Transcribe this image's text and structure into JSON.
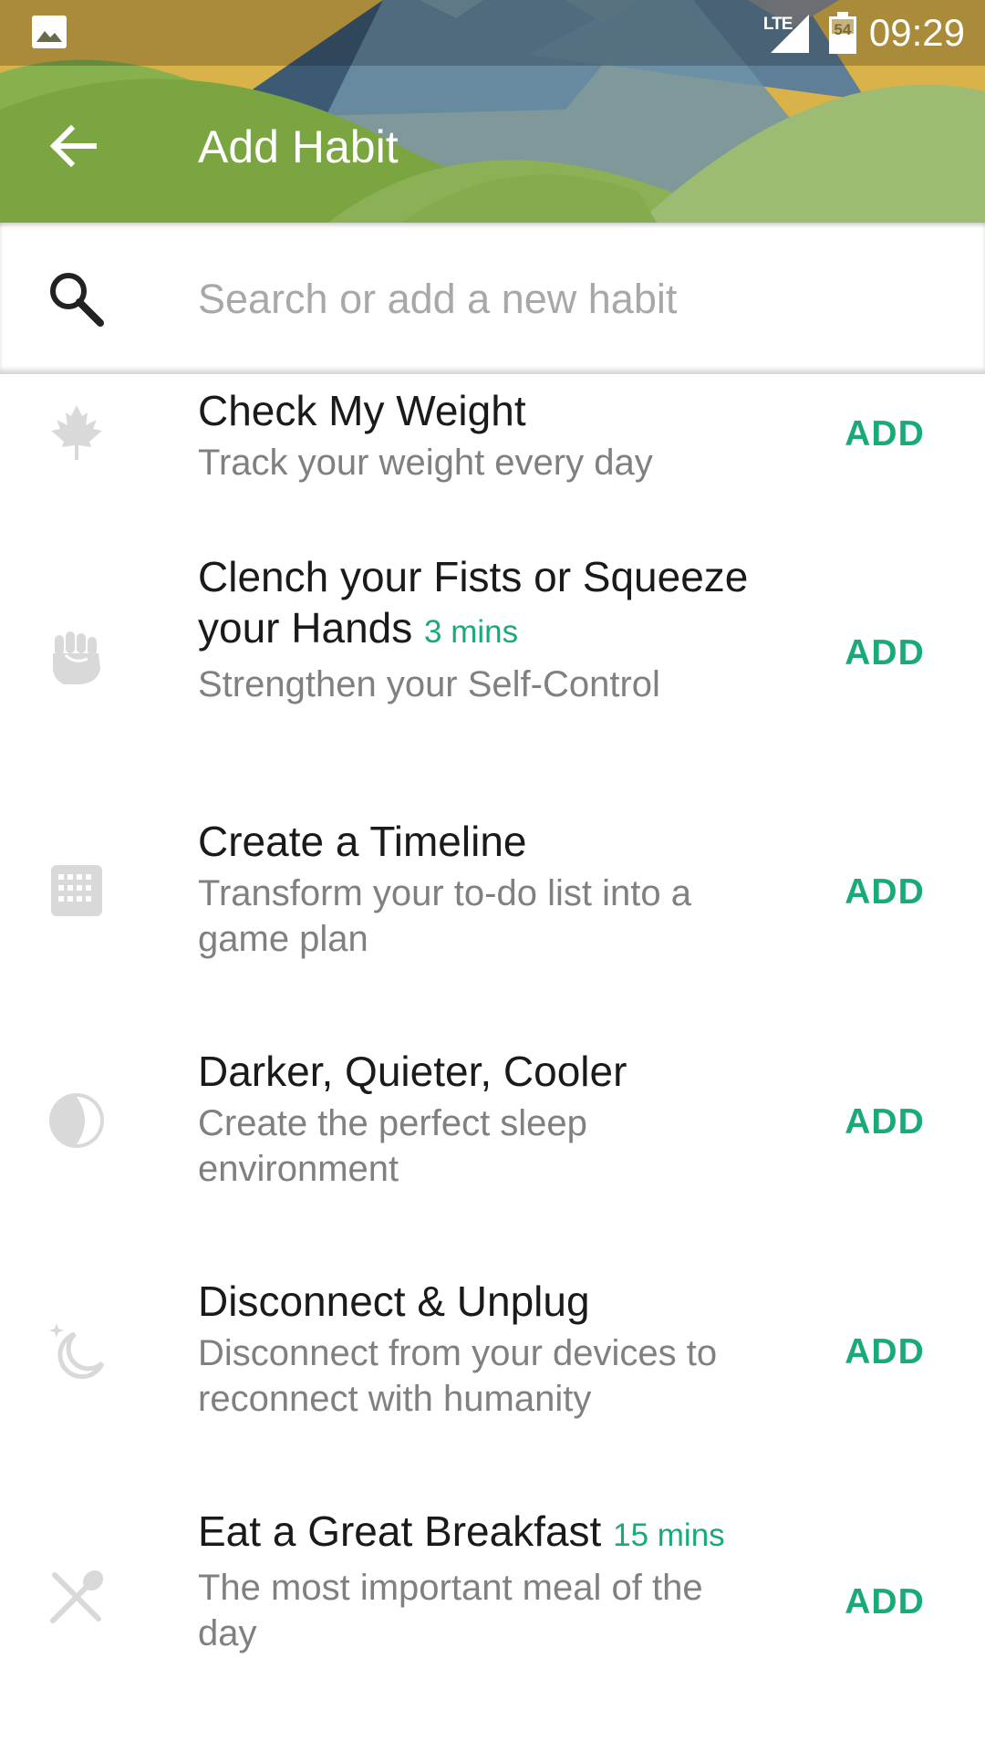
{
  "status_bar": {
    "network": "LTE",
    "battery_level": "54",
    "battery_fraction": 0.54,
    "time": "09:29"
  },
  "header": {
    "title": "Add Habit",
    "back_icon": "arrow-back-icon"
  },
  "search": {
    "placeholder": "Search or add a new habit",
    "value": "",
    "icon": "search-icon"
  },
  "colors": {
    "accent": "#1aaa78",
    "header_green": "#7fa94e",
    "icon_gray": "#d9d9d9"
  },
  "habits": [
    {
      "title": "Check My Weight",
      "duration": "",
      "subtitle": "Track your weight every day",
      "icon": "maple-leaf-icon",
      "action": "ADD"
    },
    {
      "title": "Clench your Fists or Squeeze your Hands",
      "duration": "3 mins",
      "subtitle": "Strengthen your Self-Control",
      "icon": "fist-icon",
      "action": "ADD"
    },
    {
      "title": "Create a Timeline",
      "duration": "",
      "subtitle": "Transform your to-do list into a game plan",
      "icon": "calendar-grid-icon",
      "action": "ADD"
    },
    {
      "title": "Darker, Quieter, Cooler",
      "duration": "",
      "subtitle": "Create the perfect sleep environment",
      "icon": "half-moon-icon",
      "action": "ADD"
    },
    {
      "title": "Disconnect & Unplug",
      "duration": "",
      "subtitle": "Disconnect from your devices to reconnect with humanity",
      "icon": "crescent-moon-star-icon",
      "action": "ADD"
    },
    {
      "title": "Eat a Great Breakfast",
      "duration": "15 mins",
      "subtitle": "The most important meal of the day",
      "icon": "utensils-icon",
      "action": "ADD"
    }
  ]
}
